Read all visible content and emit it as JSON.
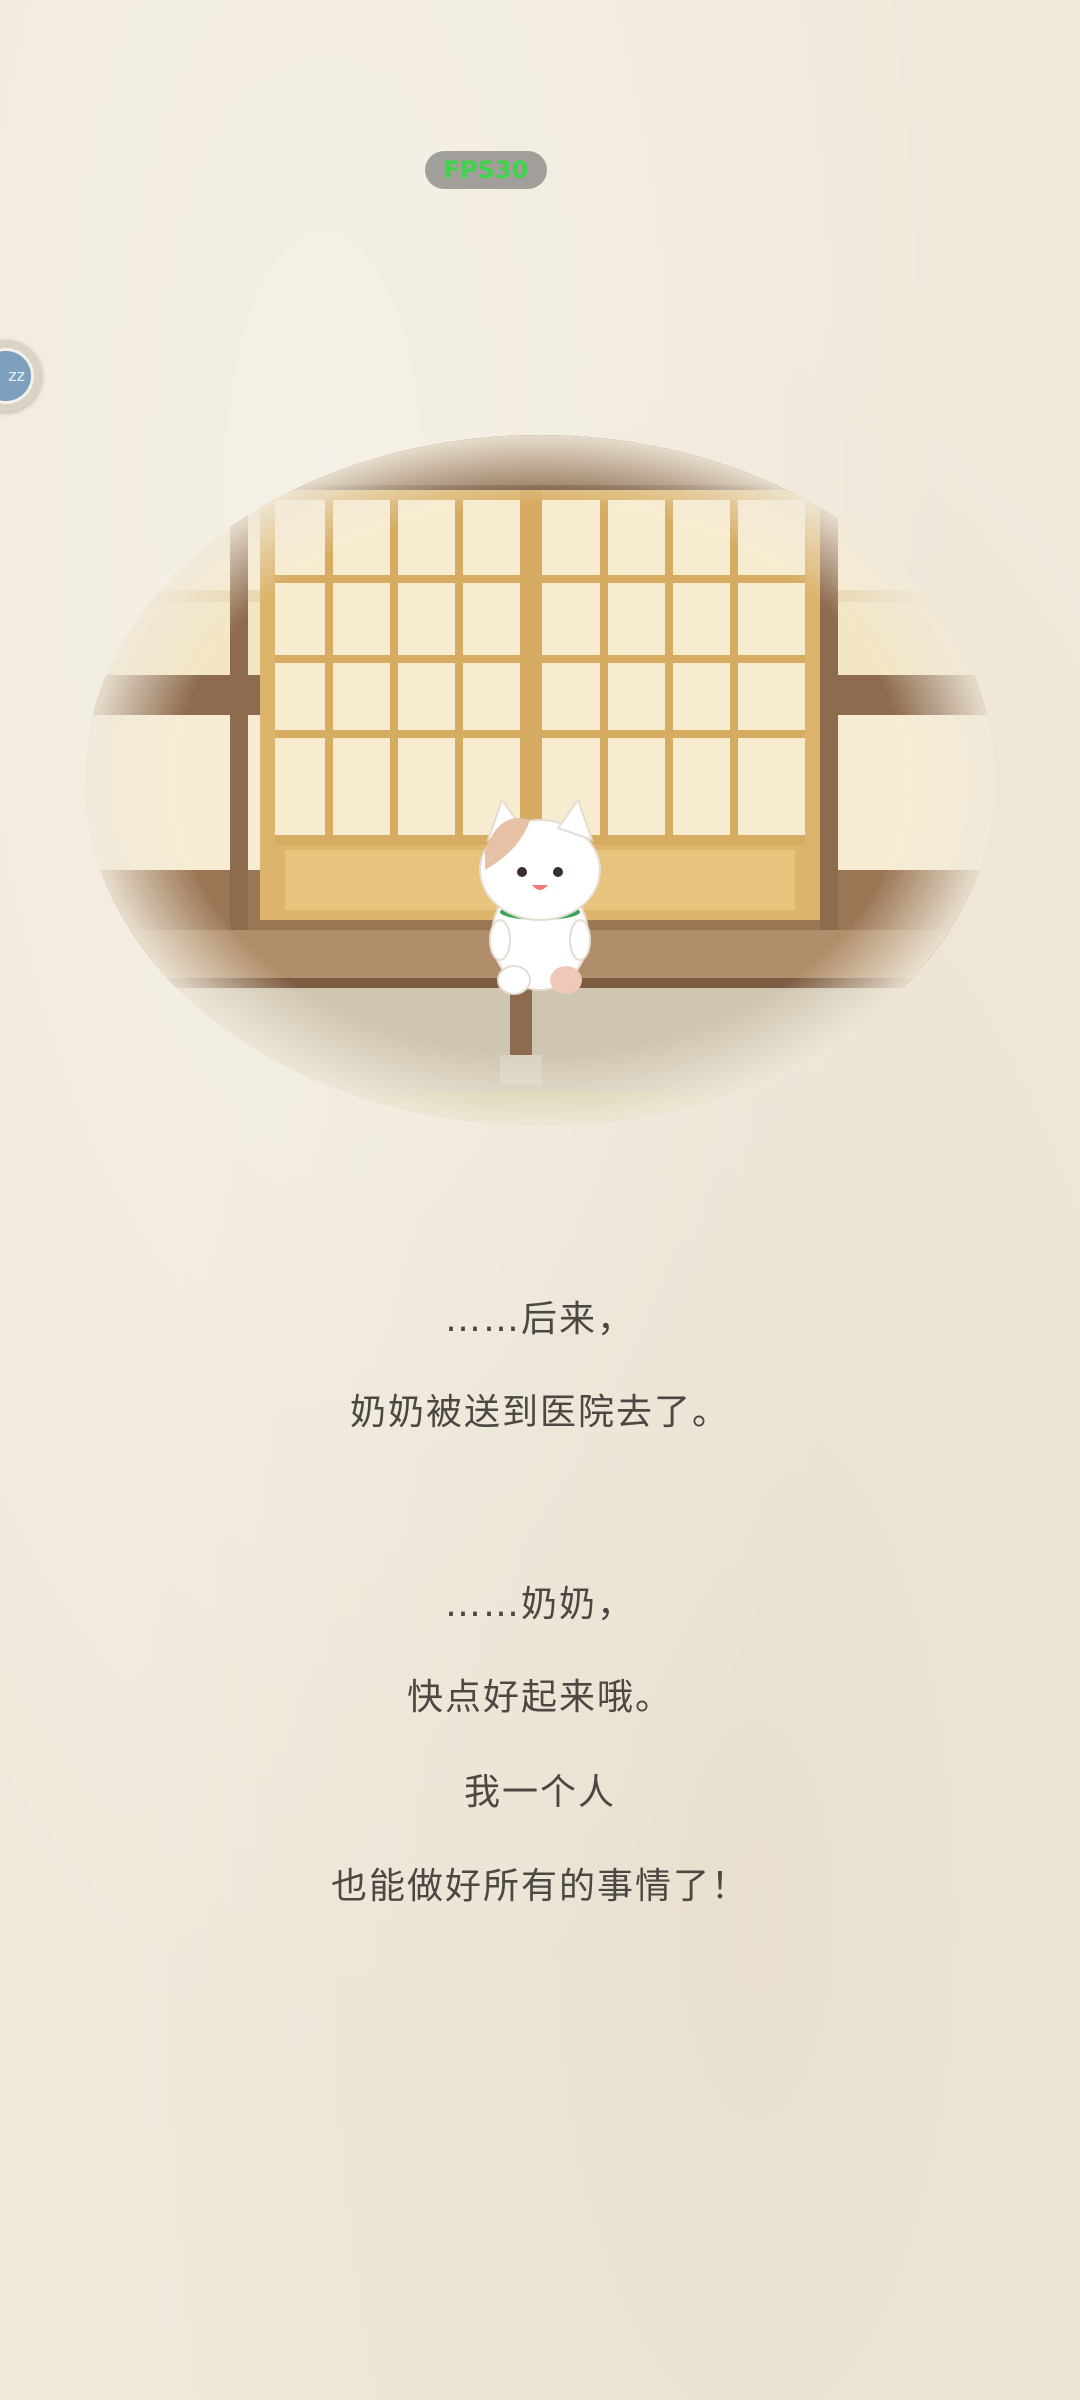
{
  "hud": {
    "fps_label": "FPS30",
    "float_bubble_text": "zz"
  },
  "scene": {
    "description_icon": "cat-on-porch-illustration"
  },
  "story": {
    "paragraph_1": [
      "……后来，",
      "奶奶被送到医院去了。"
    ],
    "paragraph_2": [
      "……奶奶，",
      "快点好起来哦。",
      "我一个人",
      "也能做好所有的事情了！"
    ]
  },
  "colors": {
    "paper": "#f0e9da",
    "text": "#4b4742",
    "fps_text": "#3fd34b",
    "wood_dark": "#8a6a4c",
    "wood_light": "#d9b574",
    "shoji_paper": "#f7ead0",
    "cat_collar": "#3aa55a"
  }
}
